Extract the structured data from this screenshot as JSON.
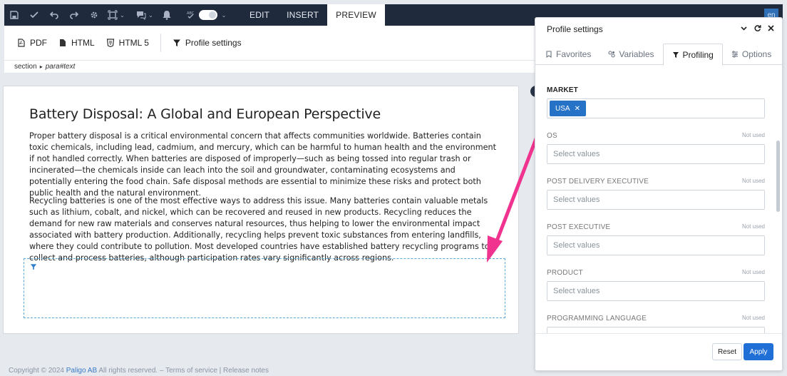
{
  "toolbar": {
    "icons": [
      "save-icon",
      "check-icon",
      "undo-icon",
      "redo-icon",
      "settings-icon",
      "frame-icon",
      "comments-icon",
      "bell-icon",
      "spellcheck-icon"
    ],
    "tabs": [
      "EDIT",
      "INSERT",
      "PREVIEW"
    ],
    "active_tab": "PREVIEW",
    "language": "en"
  },
  "output": {
    "pdf": "PDF",
    "html": "HTML",
    "html5": "HTML 5",
    "profile_settings": "Profile settings"
  },
  "breadcrumb": {
    "section": "section",
    "path": "para#text"
  },
  "document": {
    "title": "Battery Disposal: A Global and European Perspective",
    "paragraph1": "Proper battery disposal is a critical environmental concern that affects communities worldwide. Batteries contain toxic chemicals, including lead, cadmium, and mercury, which can be harmful to human health and the environment if not handled correctly. When batteries are disposed of improperly—such as being tossed into regular trash or incinerated—the chemicals inside can leach into the soil and groundwater, contaminating ecosystems and potentially entering the food chain. Safe disposal methods are essential to minimize these risks and protect both public health and the natural environment.",
    "paragraph2": "Recycling batteries is one of the most effective ways to address this issue. Many batteries contain valuable metals such as lithium, cobalt, and nickel, which can be recovered and reused in new products. Recycling reduces the demand for new raw materials and conserves natural resources, thus helping to lower the environmental impact associated with battery production. Additionally, recycling helps prevent toxic substances from entering landfills, where they could contribute to pollution. Most developed countries have established battery recycling programs to collect and process batteries, although participation rates vary significantly across regions."
  },
  "footer": {
    "copyright": "Copyright © 2024 ",
    "company": "Paligo AB",
    "rest": " All rights reserved. – Terms of service | Release notes"
  },
  "panel": {
    "title": "Profile settings",
    "tabs": [
      "Favorites",
      "Variables",
      "Profiling",
      "Options"
    ],
    "active_tab": "Profiling",
    "market": {
      "label": "MARKET",
      "tag": "USA"
    },
    "fields": [
      {
        "label": "OS",
        "status": "Not used",
        "placeholder": "Select values"
      },
      {
        "label": "POST DELIVERY EXECUTIVE",
        "status": "Not used",
        "placeholder": "Select values"
      },
      {
        "label": "POST EXECUTIVE",
        "status": "Not used",
        "placeholder": "Select values"
      },
      {
        "label": "PRODUCT",
        "status": "Not used",
        "placeholder": "Select values"
      },
      {
        "label": "PROGRAMMING LANGUAGE",
        "status": "Not used",
        "placeholder": ""
      }
    ],
    "reset": "Reset",
    "apply": "Apply"
  },
  "colors": {
    "accent": "#1f6fd6",
    "annotation_arrow": "#f0338f",
    "toolbar_bg": "#1f2a3c"
  }
}
